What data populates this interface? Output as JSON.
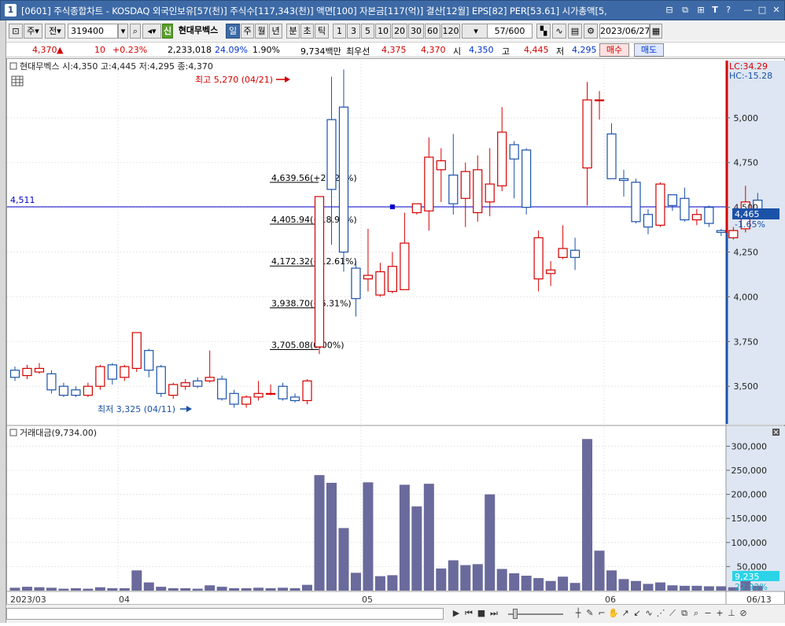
{
  "window": {
    "number": "1",
    "title": "[0601] 주식종합차트 - KOSDAQ 외국인보유[57(천)] 주식수[117,343(천)] 액면[100] 자본금[117(억)] 결산[12월] EPS[82] PER[53.61] 시가총액[5,",
    "buttons": [
      "⊟",
      "⧉",
      "⊞",
      "T",
      "?",
      "—",
      "□",
      "✕"
    ]
  },
  "toolbar": {
    "mode_a": "주",
    "mode_b": "전",
    "stock_code": "319400",
    "badge": "신",
    "stock_name": "현대무벡스",
    "periods": [
      "일",
      "주",
      "월",
      "년",
      "분",
      "초",
      "틱"
    ],
    "active_period": "일",
    "intervals": [
      "1",
      "3",
      "5",
      "10",
      "20",
      "30",
      "60",
      "120"
    ],
    "count": "57/600",
    "date": "2023/06/27"
  },
  "quote": {
    "price": "4,370",
    "direction": "▲",
    "change": "10",
    "change_pct": "+0.23%",
    "volume": "2,233,018",
    "vol_ratio": "24.09%",
    "turnover": "1.90%",
    "value": "9,734백만",
    "best_label": "최우선",
    "best_ask": "4,375",
    "best_bid": "4,370",
    "open_label": "시",
    "open": "4,350",
    "high_label": "고",
    "high": "4,445",
    "low_label": "저",
    "low": "4,295",
    "buy": "매수",
    "sell": "매도"
  },
  "price_panel": {
    "legend": "현대무벡스 시:4,350 고:4,445 저:4,295 종:4,370",
    "lc": "LC:34.29",
    "hc": "HC:-15.28",
    "hline_value": "4,511",
    "current": "4,465",
    "current_pct": "-1.65%",
    "max_label": "최고 5,270 (04/21)",
    "min_label": "최저 3,325 (04/11)",
    "fib": [
      {
        "price": 4639.56,
        "text": "4,639.56(+25.22%)"
      },
      {
        "price": 4405.94,
        "text": "4,405.94(+18.92%)"
      },
      {
        "price": 4172.32,
        "text": "4,172.32(+12.61%)"
      },
      {
        "price": 3938.7,
        "text": "3,938.70(+6.31%)"
      },
      {
        "price": 3705.08,
        "text": "3,705.08(0.00%)"
      }
    ],
    "y_ticks": [
      "5,000",
      "4,750",
      "4,500",
      "4,250",
      "4,000",
      "3,750",
      "3,500"
    ]
  },
  "volume_panel": {
    "legend": "거래대금(9,734.00)",
    "current": "9,235",
    "current_pct": "22.92%",
    "y_ticks": [
      "300,000",
      "250,000",
      "200,000",
      "150,000",
      "100,000",
      "50,000"
    ]
  },
  "x_labels": [
    "2023/03",
    "04",
    "05",
    "06",
    "06/13"
  ],
  "colors": {
    "up": "#d40000",
    "down": "#1a52a8",
    "volume": "#6a6a9c",
    "hline": "#0000cc"
  },
  "chart_data": {
    "type": "candlestick",
    "y_range": [
      3290,
      5320
    ],
    "candles": [
      [
        3590,
        3550,
        3610,
        3530
      ],
      [
        3560,
        3600,
        3620,
        3540
      ],
      [
        3580,
        3600,
        3630,
        3570
      ],
      [
        3570,
        3480,
        3590,
        3460
      ],
      [
        3500,
        3450,
        3520,
        3440
      ],
      [
        3480,
        3450,
        3500,
        3440
      ],
      [
        3450,
        3500,
        3520,
        3440
      ],
      [
        3500,
        3610,
        3620,
        3480
      ],
      [
        3620,
        3540,
        3630,
        3510
      ],
      [
        3550,
        3610,
        3620,
        3530
      ],
      [
        3600,
        3800,
        3800,
        3580
      ],
      [
        3700,
        3590,
        3710,
        3550
      ],
      [
        3610,
        3460,
        3620,
        3440
      ],
      [
        3450,
        3510,
        3520,
        3430
      ],
      [
        3500,
        3520,
        3540,
        3480
      ],
      [
        3530,
        3500,
        3550,
        3490
      ],
      [
        3530,
        3550,
        3700,
        3520
      ],
      [
        3540,
        3430,
        3560,
        3420
      ],
      [
        3460,
        3400,
        3480,
        3380
      ],
      [
        3400,
        3440,
        3450,
        3380
      ],
      [
        3440,
        3460,
        3530,
        3420
      ],
      [
        3460,
        3460,
        3510,
        3450
      ],
      [
        3500,
        3430,
        3520,
        3420
      ],
      [
        3440,
        3420,
        3460,
        3410
      ],
      [
        3420,
        3530,
        3540,
        3400
      ],
      [
        3720,
        4560,
        4560,
        3680
      ],
      [
        4990,
        4600,
        5230,
        4290
      ],
      [
        5060,
        4250,
        5270,
        4140
      ],
      [
        4160,
        3990,
        4200,
        3890
      ],
      [
        4100,
        4120,
        4380,
        4030
      ],
      [
        4010,
        4140,
        4190,
        4000
      ],
      [
        4030,
        4170,
        4250,
        4020
      ],
      [
        4040,
        4300,
        4470,
        4040
      ],
      [
        4470,
        4520,
        4520,
        4460
      ],
      [
        4480,
        4780,
        4890,
        4370
      ],
      [
        4710,
        4760,
        4830,
        4530
      ],
      [
        4680,
        4520,
        4910,
        4460
      ],
      [
        4550,
        4700,
        4750,
        4390
      ],
      [
        4470,
        4710,
        4790,
        4420
      ],
      [
        4530,
        4630,
        4830,
        4450
      ],
      [
        4620,
        4920,
        5060,
        4590
      ],
      [
        4850,
        4770,
        4870,
        4550
      ],
      [
        4820,
        4500,
        4830,
        4460
      ],
      [
        4100,
        4330,
        4370,
        4030
      ],
      [
        4130,
        4150,
        4200,
        4060
      ],
      [
        4220,
        4270,
        4400,
        4210
      ],
      [
        4260,
        4220,
        4330,
        4150
      ],
      [
        4720,
        5100,
        5200,
        4510
      ],
      [
        5100,
        5100,
        5150,
        4990
      ],
      [
        4910,
        4660,
        4970,
        4660
      ],
      [
        4660,
        4650,
        4710,
        4560
      ],
      [
        4640,
        4420,
        4660,
        4410
      ],
      [
        4460,
        4390,
        4490,
        4350
      ],
      [
        4400,
        4630,
        4640,
        4390
      ],
      [
        4570,
        4510,
        4570,
        4480
      ],
      [
        4550,
        4430,
        4610,
        4420
      ],
      [
        4430,
        4460,
        4490,
        4400
      ],
      [
        4500,
        4410,
        4510,
        4390
      ],
      [
        4370,
        4360,
        4380,
        4340
      ],
      [
        4330,
        4370,
        4390,
        4320
      ],
      [
        4380,
        4530,
        4620,
        4360
      ],
      [
        4540,
        4470,
        4580,
        4460
      ]
    ],
    "volume_range": [
      0,
      335000
    ],
    "volumes": [
      6000,
      8000,
      7000,
      6000,
      4000,
      5000,
      4000,
      7000,
      5000,
      5000,
      42000,
      17000,
      8000,
      5000,
      5000,
      4000,
      11000,
      8000,
      5000,
      5000,
      6000,
      5000,
      6000,
      5000,
      12000,
      240000,
      224000,
      130000,
      37000,
      225000,
      30000,
      32000,
      220000,
      175000,
      222000,
      46000,
      63000,
      53000,
      55000,
      200000,
      45000,
      36000,
      31000,
      26000,
      20000,
      29000,
      16000,
      315000,
      83000,
      42000,
      24000,
      20000,
      14000,
      17000,
      11000,
      10000,
      10000,
      9000,
      9000,
      7000,
      41000,
      10000
    ]
  }
}
